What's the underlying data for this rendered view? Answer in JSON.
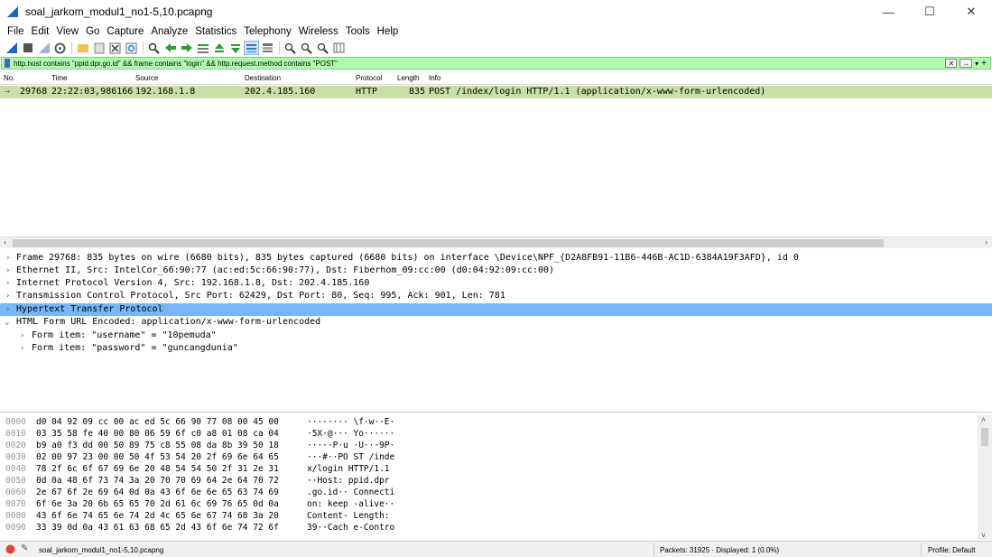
{
  "window": {
    "title": "soal_jarkom_modul1_no1-5,10.pcapng",
    "minimize": "—",
    "maximize": "☐",
    "close": "✕"
  },
  "menu": [
    "File",
    "Edit",
    "View",
    "Go",
    "Capture",
    "Analyze",
    "Statistics",
    "Telephony",
    "Wireless",
    "Tools",
    "Help"
  ],
  "filter": {
    "text": "http.host contains \"ppid.dpr.go.id\"  && frame contains \"login\" && http.request.method contains \"POST\""
  },
  "packet_list": {
    "columns": {
      "no": "No.",
      "time": "Time",
      "source": "Source",
      "destination": "Destination",
      "protocol": "Protocol",
      "length": "Length",
      "info": "Info"
    },
    "row": {
      "no": "29768",
      "time": "22:22:03,986166",
      "source": "192.168.1.8",
      "destination": "202.4.185.160",
      "protocol": "HTTP",
      "length": "835",
      "info": "POST /index/login HTTP/1.1  (application/x-www-form-urlencoded)"
    }
  },
  "details": [
    "Frame 29768: 835 bytes on wire (6680 bits), 835 bytes captured (6680 bits) on interface \\Device\\NPF_{D2A8FB91-11B6-446B-AC1D-6384A19F3AFD}, id 0",
    "Ethernet II, Src: IntelCor_66:90:77 (ac:ed:5c:66:90:77), Dst: Fiberhom_09:cc:00 (d0:04:92:09:cc:00)",
    "Internet Protocol Version 4, Src: 192.168.1.8, Dst: 202.4.185.160",
    "Transmission Control Protocol, Src Port: 62429, Dst Port: 80, Seq: 995, Ack: 901, Len: 781",
    "Hypertext Transfer Protocol",
    "HTML Form URL Encoded: application/x-www-form-urlencoded",
    "Form item: \"username\" = \"10pemuda\"",
    "Form item: \"password\" = \"guncangdunia\""
  ],
  "bytes": [
    {
      "off": "0000",
      "hex": "d0 04 92 09 cc 00 ac ed  5c 66 90 77 08 00 45 00",
      "ascii": "········ \\f·w··E·"
    },
    {
      "off": "0010",
      "hex": "03 35 58 fe 40 00 80 06  59 6f c0 a8 01 08 ca 04",
      "ascii": "·5X·@··· Yo······"
    },
    {
      "off": "0020",
      "hex": "b9 a0 f3 dd 00 50 89 75  c8 55 08 da 8b 39 50 18",
      "ascii": "·····P·u ·U···9P·"
    },
    {
      "off": "0030",
      "hex": "02 00 97 23 00 00 50 4f  53 54 20 2f 69 6e 64 65",
      "ascii": "···#··PO ST /inde"
    },
    {
      "off": "0040",
      "hex": "78 2f 6c 6f 67 69 6e 20  48 54 54 50 2f 31 2e 31",
      "ascii": "x/login  HTTP/1.1"
    },
    {
      "off": "0050",
      "hex": "0d 0a 48 6f 73 74 3a 20  70 70 69 64 2e 64 70 72",
      "ascii": "··Host:  ppid.dpr"
    },
    {
      "off": "0060",
      "hex": "2e 67 6f 2e 69 64 0d 0a  43 6f 6e 6e 65 63 74 69",
      "ascii": ".go.id·· Connecti"
    },
    {
      "off": "0070",
      "hex": "6f 6e 3a 20 6b 65 65 70  2d 61 6c 69 76 65 0d 0a",
      "ascii": "on: keep -alive··"
    },
    {
      "off": "0080",
      "hex": "43 6f 6e 74 65 6e 74 2d  4c 65 6e 67 74 68 3a 20",
      "ascii": "Content- Length: "
    },
    {
      "off": "0090",
      "hex": "33 39 0d 0a 43 61 63 68  65 2d 43 6f 6e 74 72 6f",
      "ascii": "39··Cach e-Contro"
    }
  ],
  "status": {
    "file": "soal_jarkom_modul1_no1-5,10.pcapng",
    "packets": "Packets: 31925 · Displayed: 1 (0.0%)",
    "profile": "Profile: Default"
  },
  "colors": {
    "selected_row": "#c8e0a6",
    "filter_bg": "#afffaf",
    "detail_sel": "#77b6f9",
    "accent": "#1e63c8"
  }
}
